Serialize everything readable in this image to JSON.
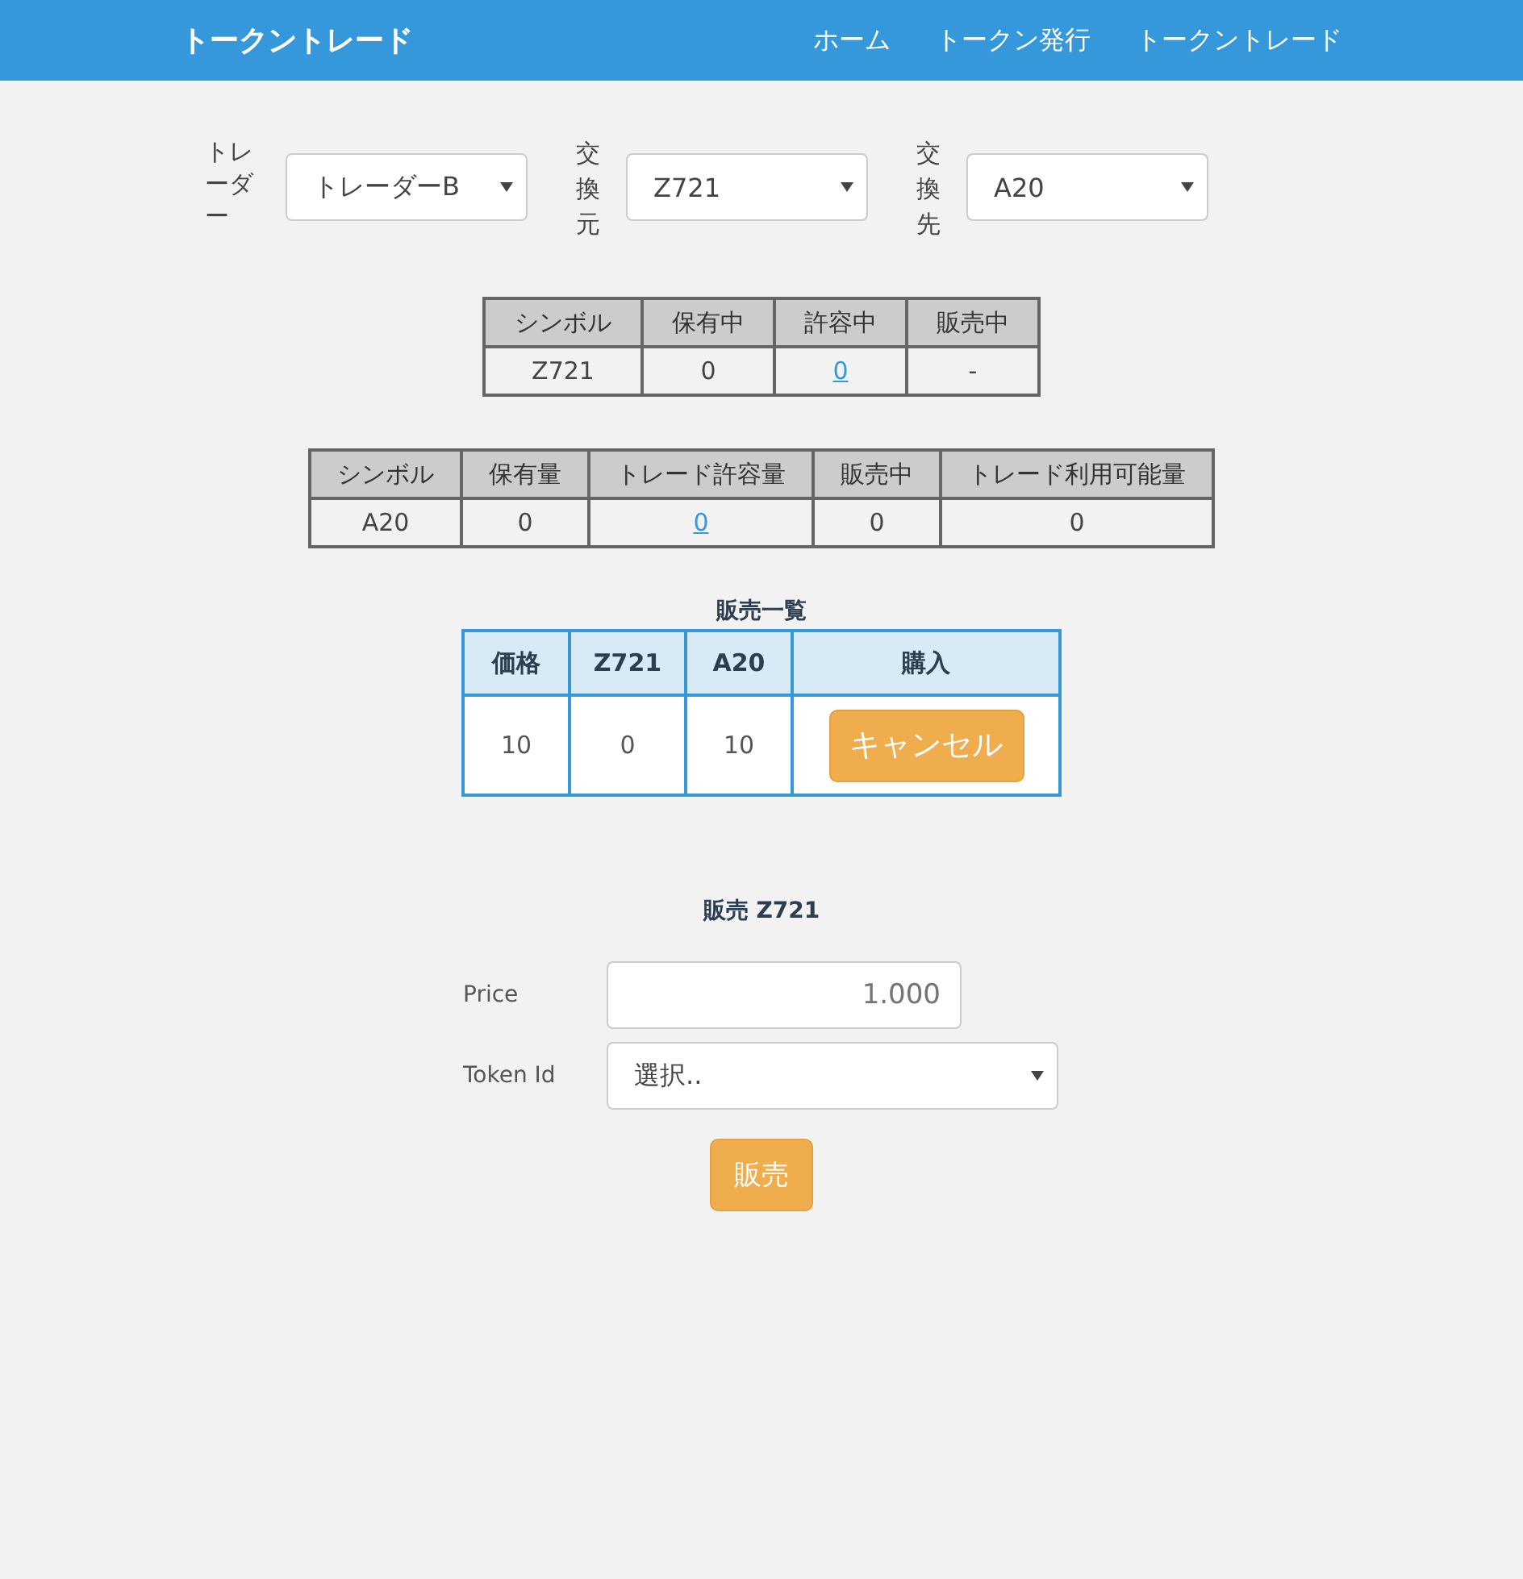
{
  "navbar": {
    "brand": "トークントレード",
    "links": [
      "ホーム",
      "トークン発行",
      "トークントレード"
    ]
  },
  "selectors": [
    {
      "label": "トレーダー",
      "value": "トレーダーB",
      "kind": "wrap"
    },
    {
      "label": "交換元",
      "value": "Z721",
      "kind": "vertical"
    },
    {
      "label": "交換先",
      "value": "A20",
      "kind": "vertical"
    }
  ],
  "source_table": {
    "columns": [
      "シンボル",
      "保有中",
      "許容中",
      "販売中"
    ],
    "rows": [
      [
        {
          "text": "Z721",
          "kind": "text"
        },
        {
          "text": "0",
          "kind": "text"
        },
        {
          "text": "0",
          "kind": "link"
        },
        {
          "text": "-",
          "kind": "text"
        }
      ]
    ]
  },
  "target_table": {
    "columns": [
      "シンボル",
      "保有量",
      "トレード許容量",
      "販売中",
      "トレード利用可能量"
    ],
    "rows": [
      [
        {
          "text": "A20",
          "kind": "text"
        },
        {
          "text": "0",
          "kind": "text"
        },
        {
          "text": "0",
          "kind": "link"
        },
        {
          "text": "0",
          "kind": "text"
        },
        {
          "text": "0",
          "kind": "text"
        }
      ]
    ]
  },
  "sales_list": {
    "title": "販売一覧",
    "columns": [
      "価格",
      "Z721",
      "A20",
      "購入"
    ],
    "rows": [
      {
        "cells": [
          "10",
          "0",
          "10"
        ],
        "button": "キャンセル"
      }
    ]
  },
  "sell_form": {
    "title": "販売 Z721",
    "price": {
      "label": "Price",
      "placeholder": "1.000"
    },
    "token_id": {
      "label": "Token Id",
      "value": "選択.."
    },
    "button": "販売"
  }
}
